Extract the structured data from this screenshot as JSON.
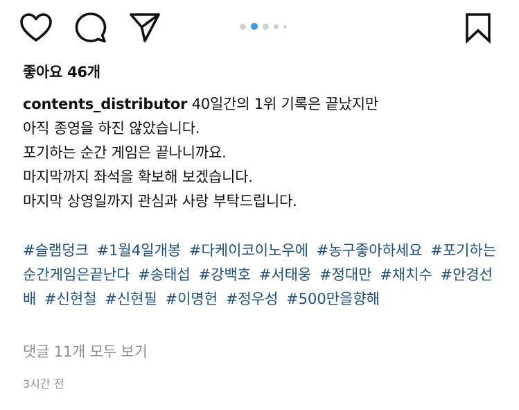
{
  "post": {
    "likes_text": "좋아요 46개",
    "username": "contents_distributor",
    "caption_lines": [
      "40일간의 1위 기록은 끝났지만",
      "아직 종영을 하진 않았습니다.",
      "포기하는 순간 게임은 끝나니까요.",
      "마지막까지 좌석을 확보해 보겠습니다.",
      "마지막 상영일까지 관심과 사랑 부탁드립니다."
    ],
    "hashtags": [
      "#슬램덩크",
      "#1월4일개봉",
      "#다케이코이노우에",
      "#농구좋아하세요",
      "#포기하는순간게임은끝난다",
      "#송태섭",
      "#강백호",
      "#서태웅",
      "#정대만",
      "#채치수",
      "#안경선배",
      "#신현철",
      "#신현필",
      "#이명헌",
      "#정우성",
      "#500만을향해"
    ],
    "view_comments_text": "댓글 11개 모두 보기",
    "timestamp": "3시간 전"
  },
  "actions": {
    "like_icon": "heart-outline-icon",
    "comment_icon": "speech-bubble-icon",
    "share_icon": "paper-plane-icon",
    "save_icon": "bookmark-outline-icon"
  },
  "carousel": {
    "total_dots": 5,
    "active_index": 1
  },
  "colors": {
    "hashtag": "#1a4f85",
    "muted": "#8e8e8e",
    "active_dot": "#3897f0",
    "inactive_dot": "#d0d0d0"
  }
}
